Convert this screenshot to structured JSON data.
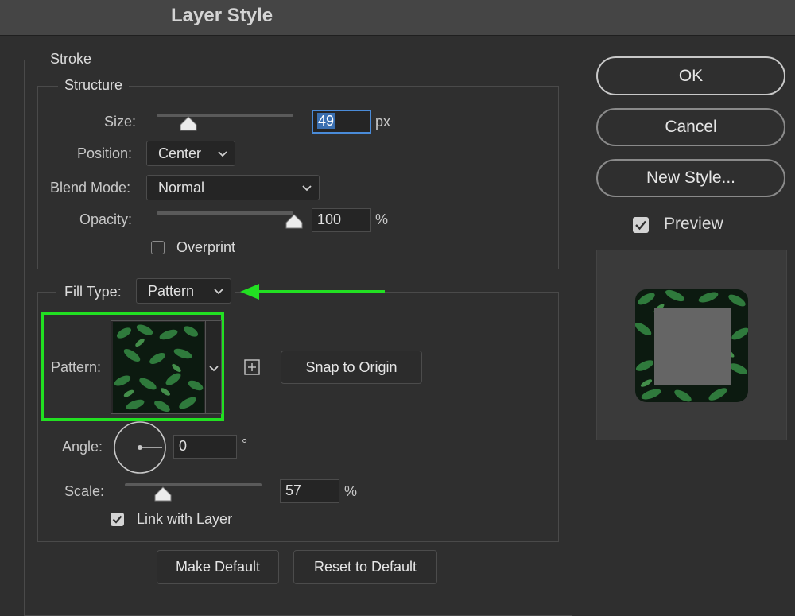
{
  "window": {
    "title": "Layer Style"
  },
  "stroke": {
    "group_title": "Stroke",
    "structure": {
      "group_title": "Structure",
      "size": {
        "label": "Size:",
        "value": "49",
        "unit": "px",
        "slider_fraction": 0.25
      },
      "position": {
        "label": "Position:",
        "value": "Center"
      },
      "blend_mode": {
        "label": "Blend Mode:",
        "value": "Normal"
      },
      "opacity": {
        "label": "Opacity:",
        "value": "100",
        "unit": "%",
        "slider_fraction": 1.0
      },
      "overprint": {
        "label": "Overprint",
        "checked": false
      }
    },
    "fill_type": {
      "label": "Fill Type:",
      "value": "Pattern",
      "pattern": {
        "label": "Pattern:"
      },
      "snap_label": "Snap to Origin",
      "angle": {
        "label": "Angle:",
        "value": "0",
        "unit": "°"
      },
      "scale": {
        "label": "Scale:",
        "value": "57",
        "unit": "%",
        "slider_fraction": 0.28
      },
      "link_with_layer": {
        "label": "Link with Layer",
        "checked": true
      }
    },
    "buttons": {
      "make_default": "Make Default",
      "reset_default": "Reset to Default"
    }
  },
  "side": {
    "ok": "OK",
    "cancel": "Cancel",
    "new_style": "New Style...",
    "preview": {
      "label": "Preview",
      "checked": true
    }
  },
  "colors": {
    "annotation_green": "#22e022",
    "focus_blue": "#4a8bd8"
  }
}
